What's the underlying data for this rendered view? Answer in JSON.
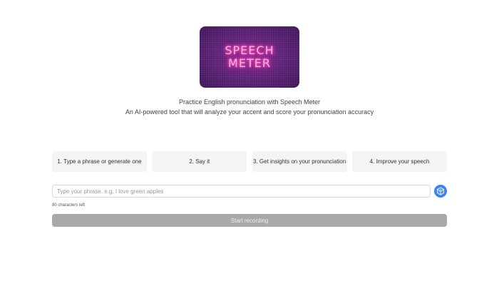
{
  "logo": {
    "line1": "SPEECH",
    "line2": "METER"
  },
  "tagline": {
    "title": "Practice English pronunciation with Speech Meter",
    "subtitle": "An AI-powered tool that will analyze your accent and score your pronunciation accuracy"
  },
  "steps": [
    {
      "label": "1. Type a phrase or generate one"
    },
    {
      "label": "2. Say it"
    },
    {
      "label": "3. Get insights on your pronunciation"
    },
    {
      "label": "4. Improve your speech"
    }
  ],
  "phrase_input": {
    "value": "",
    "placeholder": "Type your phrase. e.g. I love green apples"
  },
  "generate_button": {
    "icon": "dice-icon"
  },
  "chars_left": "80 characters left",
  "record_button": {
    "label": "Start recording"
  },
  "colors": {
    "accent": "#3b82f6",
    "logo_background": "#5a1f73",
    "neon": "#ff5fc8",
    "step_background": "#f3f4f6",
    "disabled_button": "#a9a9a9"
  }
}
